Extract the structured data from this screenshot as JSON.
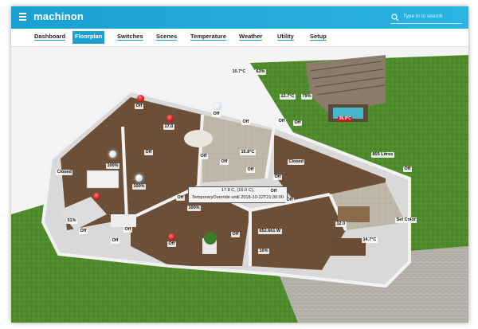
{
  "app": {
    "brand": "machinon"
  },
  "search": {
    "placeholder": "Type in to search"
  },
  "tabs": [
    {
      "label": "Dashboard"
    },
    {
      "label": "Floorplan"
    },
    {
      "label": "Switches"
    },
    {
      "label": "Scenes"
    },
    {
      "label": "Temperature"
    },
    {
      "label": "Weather"
    },
    {
      "label": "Utility"
    },
    {
      "label": "Setup"
    }
  ],
  "active_tab": "Floorplan",
  "colors": {
    "accent": "#1aa0d3",
    "alert": "#c81a1a"
  },
  "floorplan": {
    "labels": {
      "outdoor_temp": "10.7°C",
      "outdoor_hum": "63%",
      "pergola_temp": "12.7°C",
      "pergola_hum": "79%",
      "hot_tub": "38.9°C",
      "bedroom1_temp": "17.0",
      "bedroom1_light": "Off",
      "bath_off": "Off",
      "hall_off": "Off",
      "kitchen_temp": "16.8°C",
      "window_off": "Off",
      "pergola_off": "Off",
      "closed_left": "Closed",
      "dining_pct": "100%",
      "dining_pct2": "100%",
      "dining_off": "Off",
      "kitchen_off1": "Off",
      "kitchen_off2": "Off",
      "hall_off2": "Off",
      "laundry_off": "Off",
      "closed_mid": "Closed",
      "water": "855 Litres",
      "garden_off": "Off",
      "study_off": "Off",
      "living_off": "Off",
      "living_pct": "100%",
      "lounge_pct": "51%",
      "lounge_off": "Off",
      "lounge_off2": "Off",
      "lounge_off3": "Off",
      "entry_off": "Off",
      "entry_off2": "Off",
      "power": "652.661 W",
      "bath_pct": "10%",
      "bedroom2_temp": "12.0",
      "bedroom2_temp2": "14.7°C",
      "set_color": "Set Color",
      "bedroom_off": "Off",
      "bath_alert": "Off",
      "living_alert": "Off"
    },
    "tooltip": {
      "line1": "17.8 C, (16.0 C),",
      "line2": "TemporaryOverride until 2018-10-22T21:30:00"
    }
  }
}
